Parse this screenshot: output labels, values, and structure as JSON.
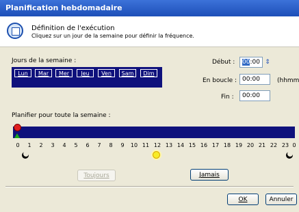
{
  "window": {
    "title": "Planification hebdomadaire"
  },
  "header": {
    "title": "Définition de l'exécution",
    "subtitle": "Cliquez sur un jour de la semaine pour définir la fréquence."
  },
  "days_section": {
    "label": "Jours de la semaine :",
    "days": [
      "Lun",
      "Mar",
      "Mer",
      "Jeu",
      "Ven",
      "Sam",
      "Dim"
    ]
  },
  "time": {
    "start_label": "Début :",
    "start_value_hour": "00",
    "start_value_rest": ":00",
    "loop_label": "En boucle :",
    "loop_value": "00:00",
    "loop_unit": "(hhmm)",
    "end_label": "Fin :",
    "end_value": "00:00"
  },
  "week_plan": {
    "label": "Planifier pour toute la semaine :",
    "hours": [
      "0",
      "1",
      "2",
      "3",
      "4",
      "5",
      "6",
      "7",
      "8",
      "9",
      "10",
      "11",
      "12",
      "13",
      "14",
      "15",
      "16",
      "17",
      "18",
      "19",
      "20",
      "21",
      "22",
      "23",
      "0"
    ],
    "bar_color": "#0f117c"
  },
  "buttons": {
    "always": "Toujours",
    "never": "Jamais",
    "ok": "OK",
    "cancel": "Annuler"
  },
  "icons": [
    "schedule-icon",
    "spin-arrows-icon",
    "moon-icon",
    "sun-icon",
    "red-knob-icon",
    "green-marker-icon"
  ]
}
